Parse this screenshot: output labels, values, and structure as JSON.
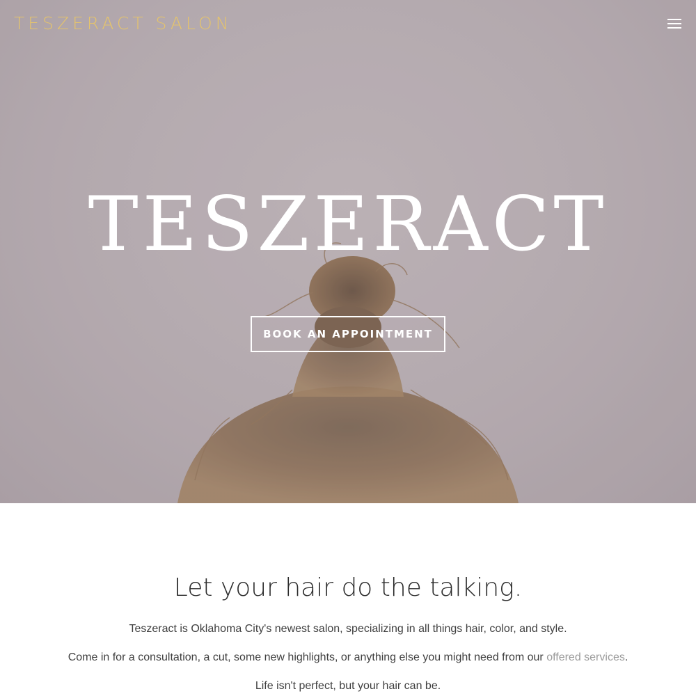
{
  "header": {
    "brand": "TESZERACT SALON",
    "menu_icon": "hamburger-menu-icon"
  },
  "hero": {
    "title": "TESZERACT",
    "cta_label": "BOOK AN APPOINTMENT",
    "overlay_color": "#b3a9ae"
  },
  "intro": {
    "heading": "Let your hair do the talking.",
    "paragraph1": "Teszeract is Oklahoma City's newest salon, specializing in all things hair, color, and style.",
    "paragraph2_before": "Come in for a consultation, a cut, some new highlights, or anything else you might need from our ",
    "paragraph2_link": "offered services",
    "paragraph2_after": ".",
    "paragraph3": "Life isn't perfect, but your hair can be."
  },
  "colors": {
    "brand_gold": "#e6c46b",
    "link_gray": "#9a9a9a",
    "text_dark": "#2b2b2b"
  }
}
